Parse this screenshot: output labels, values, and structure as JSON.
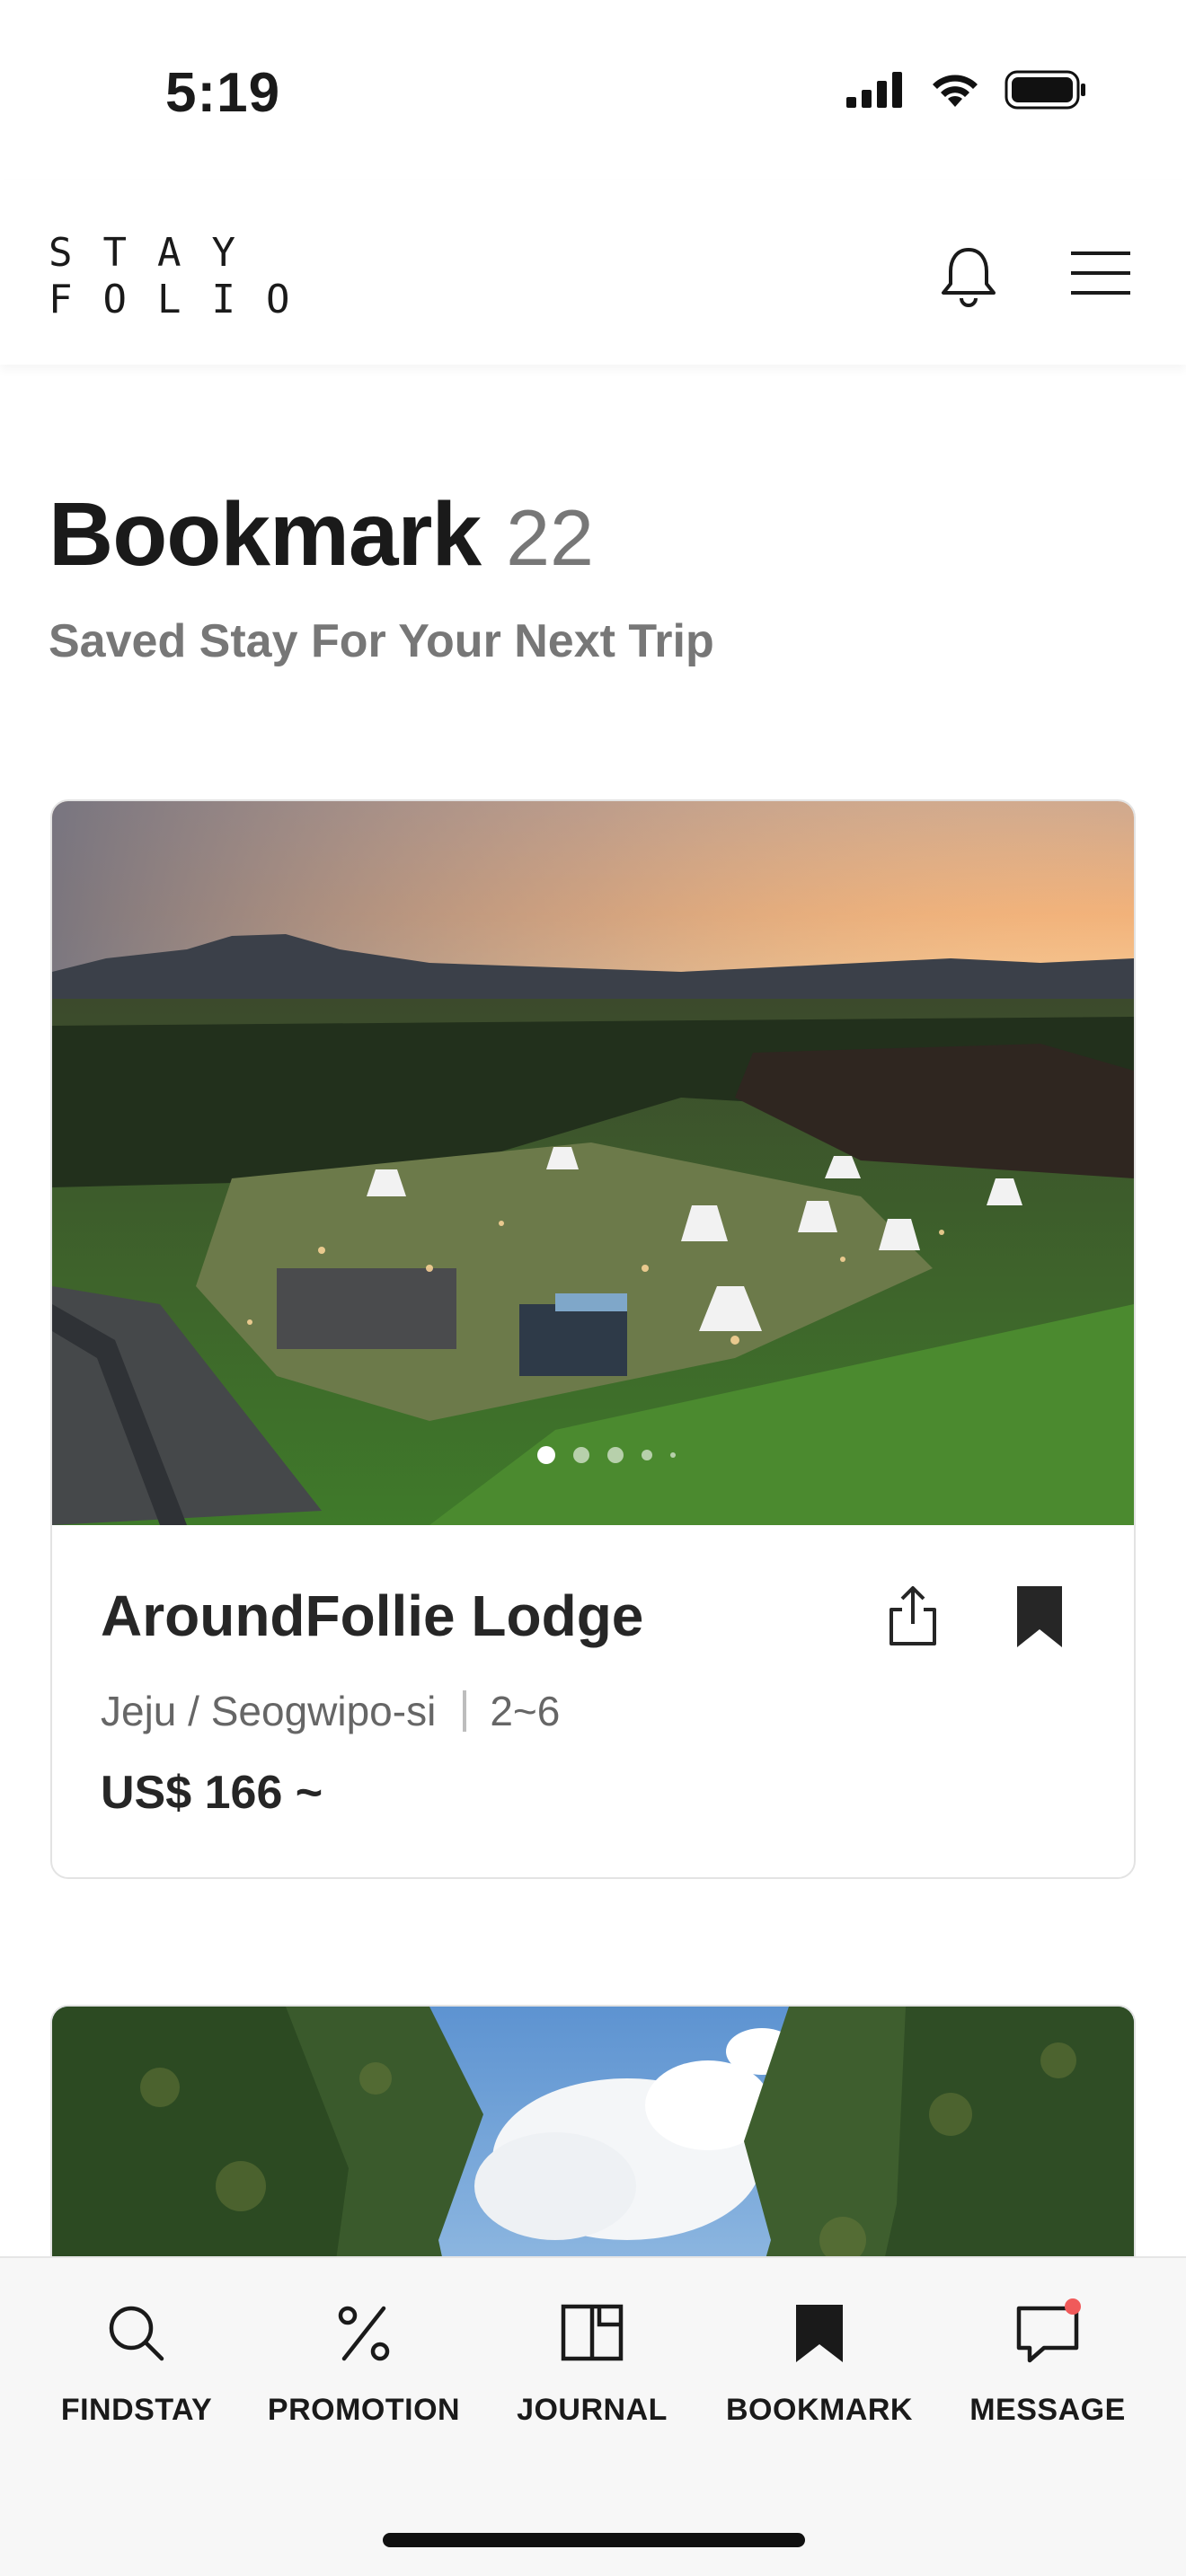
{
  "status": {
    "time": "5:19"
  },
  "header": {
    "logo_line1": "STAY",
    "logo_line2": "FOLIO"
  },
  "page": {
    "title": "Bookmark",
    "count": "22",
    "subtitle": "Saved Stay For Your Next Trip"
  },
  "cards": [
    {
      "name": "AroundFollie Lodge",
      "location": "Jeju / Seogwipo-si",
      "guests": "2~6",
      "price": "US$ 166 ~",
      "image_dots": 5,
      "active_dot": 1,
      "bookmarked": true
    }
  ],
  "nav": {
    "items": [
      {
        "label": "FINDSTAY",
        "icon": "search-icon"
      },
      {
        "label": "PROMOTION",
        "icon": "percent-icon"
      },
      {
        "label": "JOURNAL",
        "icon": "book-icon"
      },
      {
        "label": "BOOKMARK",
        "icon": "bookmark-icon",
        "active": true
      },
      {
        "label": "MESSAGE",
        "icon": "message-icon",
        "has_notification": true
      }
    ]
  },
  "colors": {
    "notification_dot": "#f05a5a",
    "text_primary": "#1a1a1a",
    "text_secondary": "#777777"
  }
}
